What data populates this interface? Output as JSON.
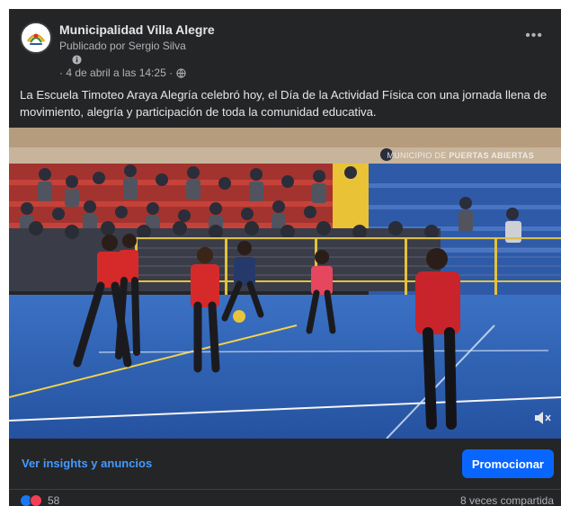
{
  "post": {
    "page_name": "Municipalidad Villa Alegre",
    "publisher": "Publicado por Sergio Silva",
    "date": "· 4 de abril a las 14:25 ·",
    "more_icon": "more-options-icon",
    "caption": "La Escuela Timoteo Araya Alegría celebró hoy, el Día de la Actividad Física con una jornada llena de movimiento, alegría y participación de toda la comunidad educativa."
  },
  "media": {
    "watermark_prefix": "MUNICIPIO DE ",
    "watermark_bold": "PUERTAS ABIERTAS",
    "mute_icon": "speaker-muted-icon"
  },
  "actions": {
    "insights_label": "Ver insights y anuncios",
    "promote_label": "Promocionar"
  },
  "footer": {
    "reaction_count": "58",
    "shares_label": "8 veces compartida"
  },
  "colors": {
    "card_background": "#242526",
    "link": "#4599ff",
    "promote_button": "#0866ff",
    "court_floor": "#2d62b6",
    "jersey_red": "#d62a2a"
  }
}
